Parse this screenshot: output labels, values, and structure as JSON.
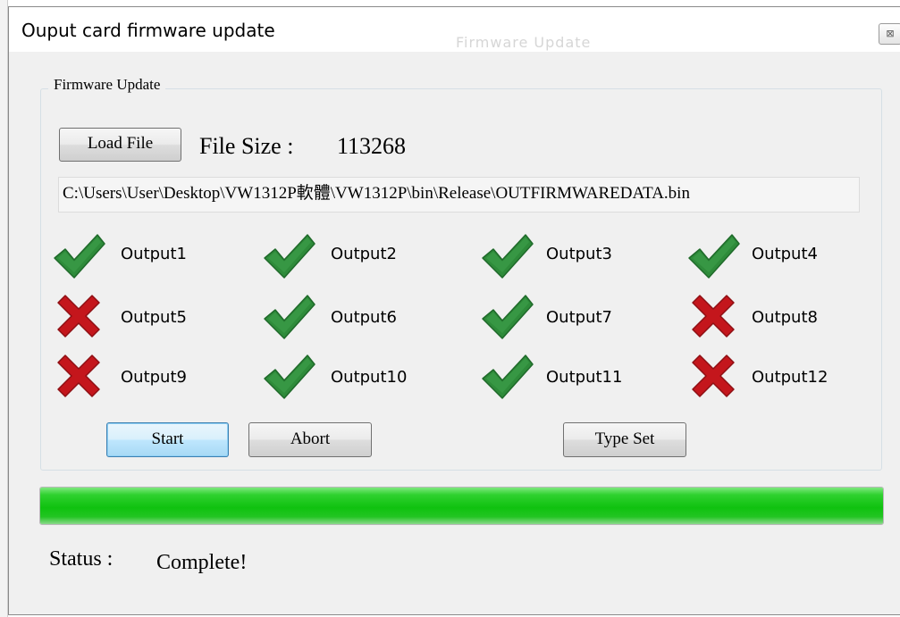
{
  "window": {
    "title": "Ouput card firmware update",
    "ghost_title": "Firmware Update",
    "close_glyph": "⊠"
  },
  "group": {
    "legend": "Firmware Update"
  },
  "load_file": {
    "button_label": "Load File",
    "file_size_label": "File Size :",
    "file_size_value": "113268"
  },
  "path": {
    "value": "C:\\Users\\User\\Desktop\\VW1312P軟體\\VW1312P\\bin\\Release\\OUTFIRMWAREDATA.bin"
  },
  "outputs": [
    {
      "label": "Output1",
      "status": "success",
      "icon": "check-icon"
    },
    {
      "label": "Output2",
      "status": "success",
      "icon": "check-icon"
    },
    {
      "label": "Output3",
      "status": "success",
      "icon": "check-icon"
    },
    {
      "label": "Output4",
      "status": "success",
      "icon": "check-icon"
    },
    {
      "label": "Output5",
      "status": "failure",
      "icon": "cross-icon"
    },
    {
      "label": "Output6",
      "status": "success",
      "icon": "check-icon"
    },
    {
      "label": "Output7",
      "status": "success",
      "icon": "check-icon"
    },
    {
      "label": "Output8",
      "status": "failure",
      "icon": "cross-icon"
    },
    {
      "label": "Output9",
      "status": "failure",
      "icon": "cross-icon"
    },
    {
      "label": "Output10",
      "status": "success",
      "icon": "check-icon"
    },
    {
      "label": "Output11",
      "status": "success",
      "icon": "check-icon"
    },
    {
      "label": "Output12",
      "status": "failure",
      "icon": "cross-icon"
    }
  ],
  "buttons": {
    "start": "Start",
    "abort": "Abort",
    "type_set": "Type Set"
  },
  "progress": {
    "percent": 100,
    "color": "#1ec81e"
  },
  "status": {
    "label": "Status :",
    "value": "Complete!"
  },
  "colors": {
    "success": "#2e8b3a",
    "failure": "#c4161c"
  }
}
